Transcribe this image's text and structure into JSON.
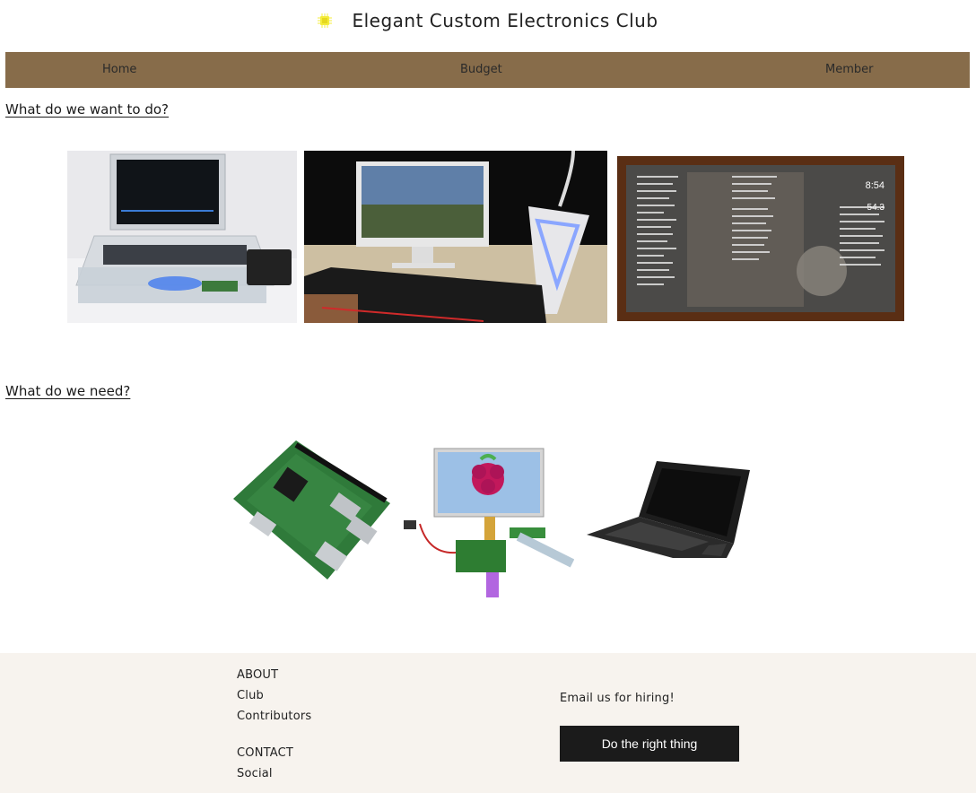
{
  "header": {
    "title": "Elegant Custom Electronics Club",
    "logo_icon": "chip-icon"
  },
  "nav": {
    "items": [
      {
        "label": "Home"
      },
      {
        "label": "Budget"
      },
      {
        "label": "Member"
      }
    ],
    "background": "#876c4a"
  },
  "sections": [
    {
      "heading": "What do we want to do?",
      "images": [
        "acrylic-laptop-image",
        "gaming-pc-setup-image",
        "smart-mirror-image"
      ]
    },
    {
      "heading": "What do we need?",
      "images": [
        "raspberry-pi-board-image",
        "lcd-display-kit-image",
        "pi-laptop-case-image"
      ]
    }
  ],
  "smart_mirror": {
    "time": "8:54",
    "temp": "54.3"
  },
  "footer": {
    "about_heading": "ABOUT",
    "about_links": [
      "Club",
      "Contributors"
    ],
    "contact_heading": "CONTACT",
    "contact_links": [
      "Social"
    ],
    "hire_text": "Email us for hiring!",
    "cta_label": "Do the right thing",
    "background": "#f7f3ee"
  }
}
